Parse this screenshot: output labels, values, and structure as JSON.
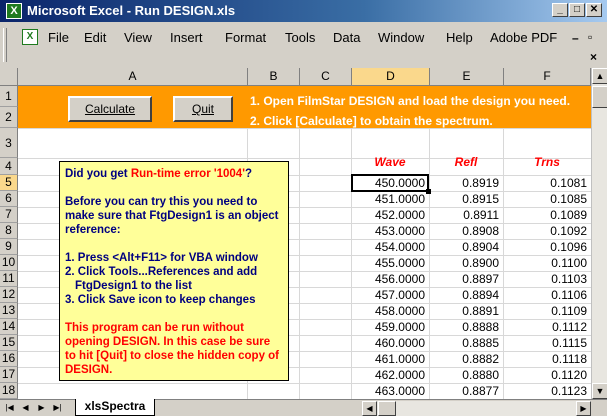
{
  "window": {
    "title": "Microsoft Excel - Run DESIGN.xls",
    "app_icon": "excel-icon",
    "minimize": "_",
    "maximize": "□",
    "close": "✕"
  },
  "menu": {
    "items": [
      "File",
      "Edit",
      "View",
      "Insert",
      "Format",
      "Tools",
      "Data",
      "Window",
      "Help",
      "Adobe PDF"
    ],
    "restore": "▫",
    "minimize": "–",
    "close": "×"
  },
  "columns": [
    "A",
    "B",
    "C",
    "D",
    "E",
    "F"
  ],
  "rows": [
    "1",
    "2",
    "3",
    "4",
    "5",
    "6",
    "7",
    "8",
    "9",
    "10",
    "11",
    "12",
    "13",
    "14",
    "15",
    "16",
    "17",
    "18"
  ],
  "buttons": {
    "calculate": "Calculate",
    "quit": "Quit"
  },
  "instructions": {
    "line1": "1. Open FilmStar DESIGN and load the design you need.",
    "line2": "2. Click [Calculate] to obtain the spectrum."
  },
  "note": {
    "q_prefix": "Did you get ",
    "q_error": "Run-time error '1004'",
    "q_suffix": "?",
    "p1": "Before you can try this you need to make sure that FtgDesign1 is an object reference:",
    "s1": "1. Press <Alt+F11> for VBA window",
    "s2a": "2. Click Tools...References and add",
    "s2b": "FtgDesign1 to the list",
    "s3": "3. Click Save icon to keep changes",
    "p2": "This program can be run without opening DESIGN. In this case be sure to hit [Quit] to close the hidden copy of DESIGN."
  },
  "table": {
    "headers": [
      "Wave",
      "Refl",
      "Trns"
    ],
    "rows": [
      [
        "450.0000",
        "0.8919",
        "0.1081"
      ],
      [
        "451.0000",
        "0.8915",
        "0.1085"
      ],
      [
        "452.0000",
        "0.8911",
        "0.1089"
      ],
      [
        "453.0000",
        "0.8908",
        "0.1092"
      ],
      [
        "454.0000",
        "0.8904",
        "0.1096"
      ],
      [
        "455.0000",
        "0.8900",
        "0.1100"
      ],
      [
        "456.0000",
        "0.8897",
        "0.1103"
      ],
      [
        "457.0000",
        "0.8894",
        "0.1106"
      ],
      [
        "458.0000",
        "0.8891",
        "0.1109"
      ],
      [
        "459.0000",
        "0.8888",
        "0.1112"
      ],
      [
        "460.0000",
        "0.8885",
        "0.1115"
      ],
      [
        "461.0000",
        "0.8882",
        "0.1118"
      ],
      [
        "462.0000",
        "0.8880",
        "0.1120"
      ],
      [
        "463.0000",
        "0.8877",
        "0.1123"
      ]
    ]
  },
  "sheet_tab": "xlsSpectra",
  "colors": {
    "band": "#ff9900",
    "note_bg": "#ffff99",
    "header_red": "#ff0000",
    "active_header": "#fad88c"
  }
}
